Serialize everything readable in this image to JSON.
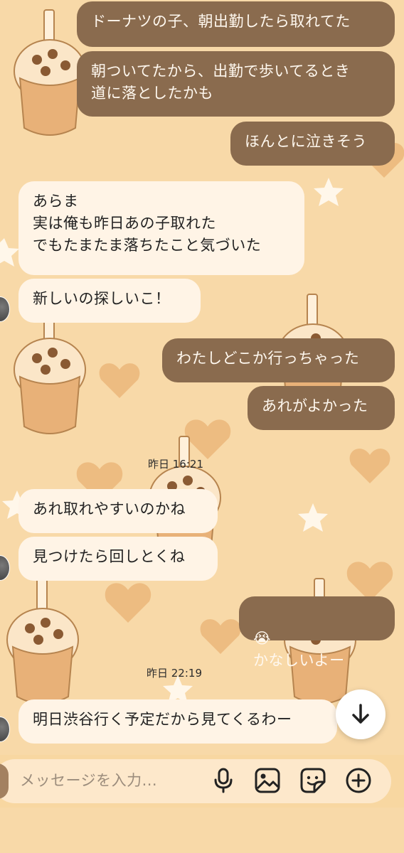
{
  "messages": [
    {
      "side": "out",
      "text": "ドーナツの子、朝出勤したら取れてた"
    },
    {
      "side": "out",
      "text": "朝ついてたから、出勤で歩いてるとき\n道に落としたかも"
    },
    {
      "side": "out",
      "text": "ほんとに泣きそう"
    },
    {
      "side": "in",
      "text": "あらま\n実は俺も昨日あの子取れた\nでもたまたま落ちたこと気づいた"
    },
    {
      "side": "in",
      "text": "新しいの探しいこ！"
    },
    {
      "side": "out",
      "text": "わたしどこか行っちゃった"
    },
    {
      "side": "out",
      "text": "あれがよかった"
    },
    {
      "side": "in",
      "text": "あれ取れやすいのかね"
    },
    {
      "side": "in",
      "text": "見つけたら回しとくね"
    },
    {
      "side": "out",
      "text": "かなしいよー",
      "emoji": "😭"
    },
    {
      "side": "in",
      "text": "明日渋谷行く予定だから見てくるわー"
    }
  ],
  "timestamps": {
    "t1": "昨日 16:21",
    "t2": "昨日 22:19"
  },
  "composer": {
    "placeholder": "メッセージを入力..."
  },
  "icons": {
    "scroll": "arrow-down-icon",
    "mic": "microphone-icon",
    "gallery": "image-icon",
    "sticker": "sticker-icon",
    "more": "plus-circle-icon"
  },
  "colors": {
    "background": "#f8d9a8",
    "outgoing_bubble": "#8a6b4e",
    "incoming_bubble": "#fff4e6"
  }
}
